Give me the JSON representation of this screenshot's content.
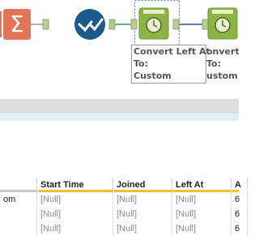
{
  "canvas": {
    "tools": [
      {
        "id": "summarize",
        "icon": "sigma-icon",
        "color": "#e2745a"
      },
      {
        "id": "filter",
        "icon": "check-icon",
        "color": "#1b5a8c"
      },
      {
        "id": "datetime1",
        "icon": "clock-icon",
        "color": "#8bb443",
        "label": "Convert Left At\nTo:\nCustom"
      },
      {
        "id": "datetime2",
        "icon": "clock-icon",
        "color": "#8bb443",
        "label": "onvert .\nTo:\nustom"
      }
    ]
  },
  "grid": {
    "columns": [
      {
        "label": "",
        "color": "#c9c9c9"
      },
      {
        "label": "Start Time",
        "color": "#f0c12c"
      },
      {
        "label": "Joined",
        "color": "#f0c12c"
      },
      {
        "label": "Left At",
        "color": "#f0c12c"
      },
      {
        "label": "A",
        "color": "#f0c12c"
      }
    ],
    "rows": [
      [
        "om",
        "[Null]",
        "[Null]",
        "[Null]",
        "6"
      ],
      [
        "",
        "[Null]",
        "[Null]",
        "[Null]",
        "6"
      ],
      [
        "",
        "[Null]",
        "[Null]",
        "[Null]",
        "6"
      ]
    ]
  }
}
